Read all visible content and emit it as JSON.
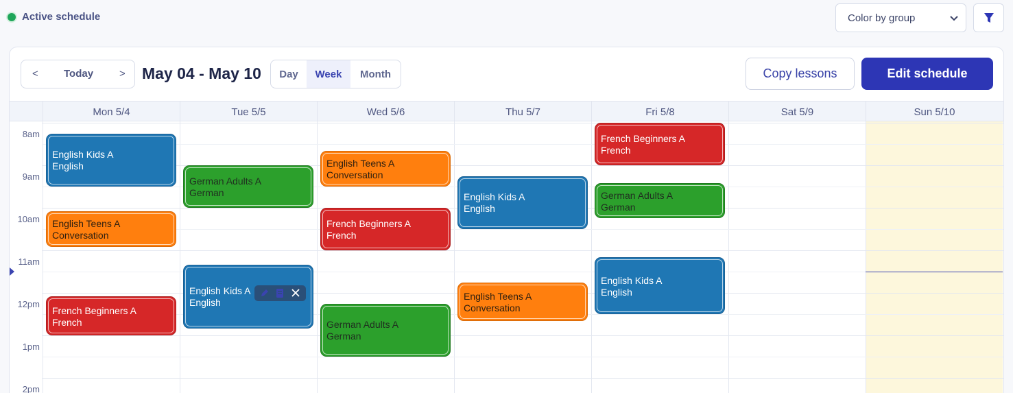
{
  "status": {
    "label": "Active schedule",
    "color": "#1fa65a"
  },
  "color_select": {
    "value": "Color by group"
  },
  "toolbar": {
    "prev": "<",
    "today": "Today",
    "next": ">",
    "range_title": "May 04 - May 10",
    "views": {
      "day": "Day",
      "week": "Week",
      "month": "Month",
      "active": "Week"
    },
    "copy_label": "Copy lessons",
    "edit_label": "Edit schedule"
  },
  "days": [
    "Mon 5/4",
    "Tue 5/5",
    "Wed 5/6",
    "Thu 5/7",
    "Fri 5/8",
    "Sat 5/9",
    "Sun 5/10"
  ],
  "times": [
    "8am",
    "9am",
    "10am",
    "11am",
    "12pm",
    "1pm",
    "2pm"
  ],
  "events": [
    {
      "day": "Mon 5/4",
      "title": "English Kids A",
      "subtitle": "English",
      "color": "blue",
      "start": "8:15",
      "end": "9:30"
    },
    {
      "day": "Mon 5/4",
      "title": "English Teens A",
      "subtitle": "Conversation",
      "color": "orange",
      "start": "10:05",
      "end": "10:55"
    },
    {
      "day": "Mon 5/4",
      "title": "French Beginners A",
      "subtitle": "French",
      "color": "red",
      "start": "12:05",
      "end": "13:00"
    },
    {
      "day": "Tue 5/5",
      "title": "German Adults A",
      "subtitle": "German",
      "color": "green",
      "start": "9:00",
      "end": "10:00"
    },
    {
      "day": "Tue 5/5",
      "title": "English Kids A",
      "subtitle": "English",
      "color": "blue",
      "start": "11:20",
      "end": "12:50",
      "selected": true
    },
    {
      "day": "Wed 5/6",
      "title": "English Teens A",
      "subtitle": "Conversation",
      "color": "orange",
      "start": "8:40",
      "end": "9:30"
    },
    {
      "day": "Wed 5/6",
      "title": "French Beginners A",
      "subtitle": "French",
      "color": "red",
      "start": "10:00",
      "end": "11:00"
    },
    {
      "day": "Wed 5/6",
      "title": "German Adults A",
      "subtitle": "German",
      "color": "green",
      "start": "12:15",
      "end": "13:30"
    },
    {
      "day": "Thu 5/7",
      "title": "English Kids A",
      "subtitle": "English",
      "color": "blue",
      "start": "9:15",
      "end": "10:30"
    },
    {
      "day": "Thu 5/7",
      "title": "English Teens A",
      "subtitle": "Conversation",
      "color": "orange",
      "start": "11:45",
      "end": "12:40"
    },
    {
      "day": "Fri 5/8",
      "title": "French Beginners A",
      "subtitle": "French",
      "color": "red",
      "start": "8:00",
      "end": "9:00"
    },
    {
      "day": "Fri 5/8",
      "title": "German Adults A",
      "subtitle": "German",
      "color": "green",
      "start": "9:25",
      "end": "10:15"
    },
    {
      "day": "Fri 5/8",
      "title": "English Kids A",
      "subtitle": "English",
      "color": "blue",
      "start": "11:10",
      "end": "12:30"
    }
  ],
  "current_time": "11:30",
  "event_actions": [
    "edit-icon",
    "notes-icon",
    "close-icon"
  ],
  "colors": {
    "blue": "#1f77b4",
    "green": "#2ca02c",
    "orange": "#ff7f0e",
    "red": "#d62728",
    "accent": "#2d36b5",
    "today_bg": "#fdf7dc"
  }
}
